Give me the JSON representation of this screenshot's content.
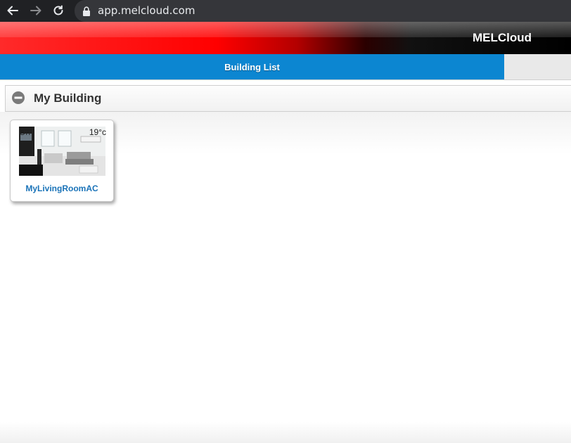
{
  "browser": {
    "url": "app.melcloud.com",
    "icons": [
      "back-arrow-icon",
      "forward-arrow-icon",
      "reload-icon",
      "lock-icon"
    ]
  },
  "app": {
    "title": "MELCloud"
  },
  "tabs": [
    {
      "label": "Building List",
      "active": true
    }
  ],
  "building": {
    "name": "My Building",
    "expanded": true
  },
  "devices": [
    {
      "name": "MyLivingRoomAC",
      "power_state": "On",
      "temperature": "19°c"
    }
  ],
  "colors": {
    "tab_active": "#0c86d1",
    "brand_red": "#ff0000",
    "device_name": "#1a73b8"
  }
}
